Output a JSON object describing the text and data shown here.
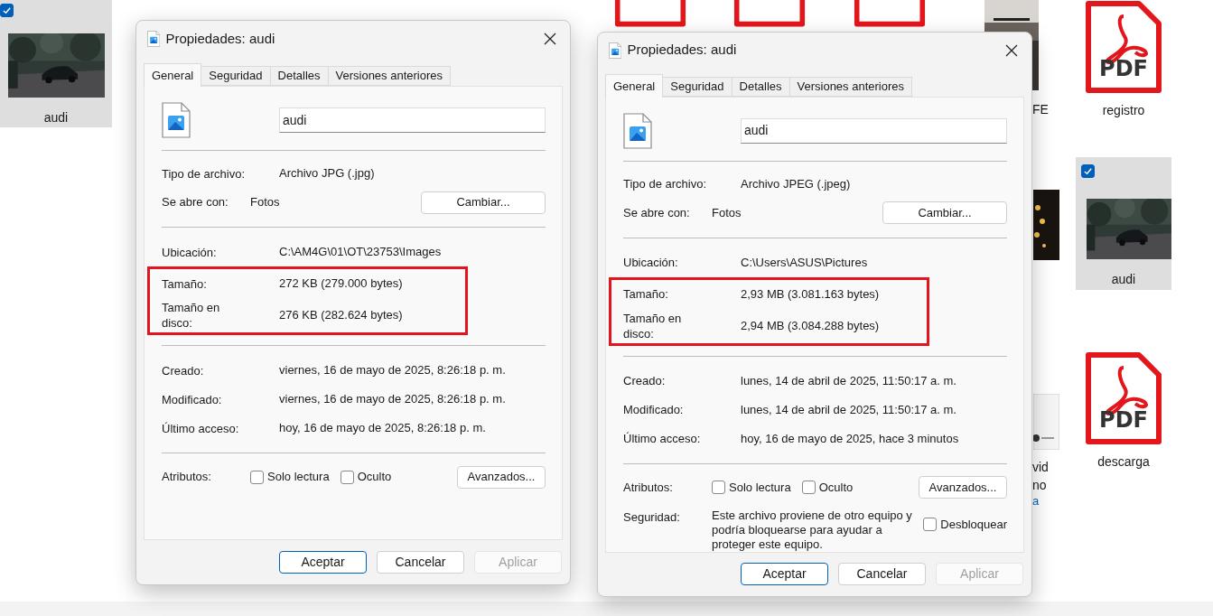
{
  "left_tile": {
    "label": "audi",
    "selected": true
  },
  "right_items": [
    {
      "kind": "pdf",
      "badge": "PDF",
      "label": "registro",
      "selected": false
    },
    {
      "label": "audi",
      "selected": true
    },
    {
      "kind": "pdf",
      "badge": "PDF",
      "label": "descarga",
      "selected": false
    }
  ],
  "fragments": [
    "FE",
    "vid",
    "no",
    "a"
  ],
  "dialogs": [
    {
      "title": "Propiedades: audi",
      "tabs": [
        {
          "label": "General",
          "selected": true
        },
        {
          "label": "Seguridad",
          "selected": false
        },
        {
          "label": "Detalles",
          "selected": false
        },
        {
          "label": "Versiones anteriores",
          "selected": false
        }
      ],
      "name": "audi",
      "file_type": {
        "label": "Tipo de archivo:",
        "value": "Archivo JPG (.jpg)"
      },
      "opens_with": {
        "label": "Se abre con:",
        "value": "Fotos",
        "button": "Cambiar..."
      },
      "location": {
        "label": "Ubicación:",
        "value": "C:\\AM4G\\01\\OT\\23753\\Images"
      },
      "highlighted": true,
      "size": {
        "label": "Tamaño:",
        "value": "272 KB (279.000 bytes)"
      },
      "disk_size": {
        "label": "Tamaño en disco:",
        "value": "276 KB (282.624 bytes)"
      },
      "dates": [
        {
          "label": "Creado:",
          "value": "viernes, 16 de mayo de 2025, 8:26:18 p. m."
        },
        {
          "label": "Modificado:",
          "value": "viernes, 16 de mayo de 2025, 8:26:18 p. m."
        },
        {
          "label": "Último acceso:",
          "value": "hoy, 16 de mayo de 2025, 8:26:18 p. m."
        }
      ],
      "attributes": {
        "label": "Atributos:",
        "options": [
          {
            "label": "Solo lectura",
            "checked": false
          },
          {
            "label": "Oculto",
            "checked": false
          }
        ],
        "button": "Avanzados..."
      },
      "buttons": [
        {
          "label": "Aceptar",
          "kind": "primary"
        },
        {
          "label": "Cancelar",
          "kind": "normal"
        },
        {
          "label": "Aplicar",
          "kind": "disabled"
        }
      ]
    },
    {
      "title": "Propiedades: audi",
      "tabs": [
        {
          "label": "General",
          "selected": true
        },
        {
          "label": "Seguridad",
          "selected": false
        },
        {
          "label": "Detalles",
          "selected": false
        },
        {
          "label": "Versiones anteriores",
          "selected": false
        }
      ],
      "name": "audi",
      "file_type": {
        "label": "Tipo de archivo:",
        "value": "Archivo JPEG (.jpeg)"
      },
      "opens_with": {
        "label": "Se abre con:",
        "value": "Fotos",
        "button": "Cambiar..."
      },
      "location": {
        "label": "Ubicación:",
        "value": "C:\\Users\\ASUS\\Pictures"
      },
      "highlighted": true,
      "size": {
        "label": "Tamaño:",
        "value": "2,93 MB (3.081.163 bytes)"
      },
      "disk_size": {
        "label": "Tamaño en disco:",
        "value": "2,94 MB (3.084.288 bytes)"
      },
      "dates": [
        {
          "label": "Creado:",
          "value": "lunes, 14 de abril de 2025, 11:50:17 a. m."
        },
        {
          "label": "Modificado:",
          "value": "lunes, 14 de abril de 2025, 11:50:17 a. m."
        },
        {
          "label": "Último acceso:",
          "value": "hoy, 16 de mayo de 2025, hace 3 minutos"
        }
      ],
      "attributes": {
        "label": "Atributos:",
        "options": [
          {
            "label": "Solo lectura",
            "checked": false
          },
          {
            "label": "Oculto",
            "checked": false
          }
        ],
        "button": "Avanzados..."
      },
      "security": {
        "label": "Seguridad:",
        "text": "Este archivo proviene de otro equipo y podría bloquearse para ayudar a proteger este equipo.",
        "option": {
          "label": "Desbloquear",
          "checked": false
        }
      },
      "buttons": [
        {
          "label": "Aceptar",
          "kind": "primary"
        },
        {
          "label": "Cancelar",
          "kind": "normal"
        },
        {
          "label": "Aplicar",
          "kind": "disabled"
        }
      ]
    }
  ]
}
